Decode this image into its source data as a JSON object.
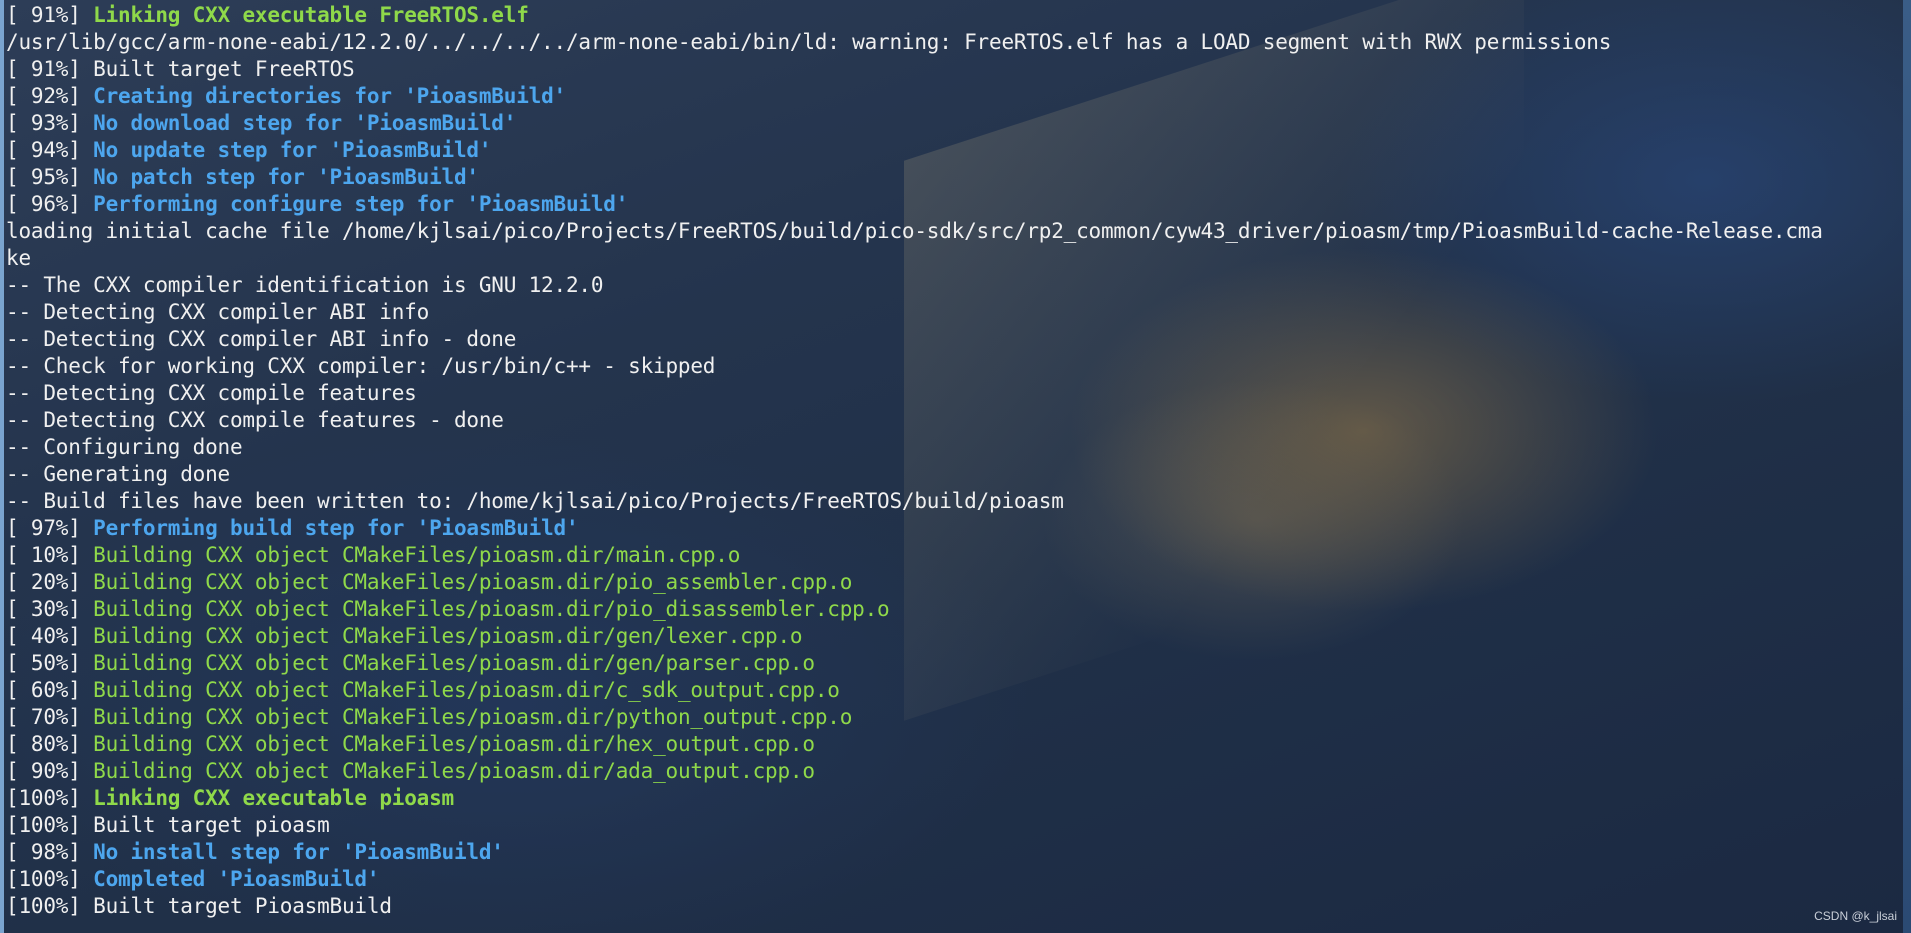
{
  "terminal": {
    "lines": [
      {
        "pct": "[ 91%]",
        "text": "Linking CXX executable FreeRTOS.elf",
        "style": "green-bold"
      },
      {
        "pct": "",
        "text": "/usr/lib/gcc/arm-none-eabi/12.2.0/../../../../arm-none-eabi/bin/ld: warning: FreeRTOS.elf has a LOAD segment with RWX permissions",
        "style": "default"
      },
      {
        "pct": "[ 91%]",
        "text": "Built target FreeRTOS",
        "style": "default"
      },
      {
        "pct": "[ 92%]",
        "text": "Creating directories for 'PioasmBuild'",
        "style": "blue-bold"
      },
      {
        "pct": "[ 93%]",
        "text": "No download step for 'PioasmBuild'",
        "style": "blue-bold"
      },
      {
        "pct": "[ 94%]",
        "text": "No update step for 'PioasmBuild'",
        "style": "blue-bold"
      },
      {
        "pct": "[ 95%]",
        "text": "No patch step for 'PioasmBuild'",
        "style": "blue-bold"
      },
      {
        "pct": "[ 96%]",
        "text": "Performing configure step for 'PioasmBuild'",
        "style": "blue-bold"
      },
      {
        "pct": "",
        "text": "loading initial cache file /home/kjlsai/pico/Projects/FreeRTOS/build/pico-sdk/src/rp2_common/cyw43_driver/pioasm/tmp/PioasmBuild-cache-Release.cma",
        "style": "default"
      },
      {
        "pct": "",
        "text": "ke",
        "style": "default"
      },
      {
        "pct": "",
        "text": "-- The CXX compiler identification is GNU 12.2.0",
        "style": "default"
      },
      {
        "pct": "",
        "text": "-- Detecting CXX compiler ABI info",
        "style": "default"
      },
      {
        "pct": "",
        "text": "-- Detecting CXX compiler ABI info - done",
        "style": "default"
      },
      {
        "pct": "",
        "text": "-- Check for working CXX compiler: /usr/bin/c++ - skipped",
        "style": "default"
      },
      {
        "pct": "",
        "text": "-- Detecting CXX compile features",
        "style": "default"
      },
      {
        "pct": "",
        "text": "-- Detecting CXX compile features - done",
        "style": "default"
      },
      {
        "pct": "",
        "text": "-- Configuring done",
        "style": "default"
      },
      {
        "pct": "",
        "text": "-- Generating done",
        "style": "default"
      },
      {
        "pct": "",
        "text": "-- Build files have been written to: /home/kjlsai/pico/Projects/FreeRTOS/build/pioasm",
        "style": "default"
      },
      {
        "pct": "[ 97%]",
        "text": "Performing build step for 'PioasmBuild'",
        "style": "blue-bold"
      },
      {
        "pct": "[ 10%]",
        "text": "Building CXX object CMakeFiles/pioasm.dir/main.cpp.o",
        "style": "green"
      },
      {
        "pct": "[ 20%]",
        "text": "Building CXX object CMakeFiles/pioasm.dir/pio_assembler.cpp.o",
        "style": "green"
      },
      {
        "pct": "[ 30%]",
        "text": "Building CXX object CMakeFiles/pioasm.dir/pio_disassembler.cpp.o",
        "style": "green"
      },
      {
        "pct": "[ 40%]",
        "text": "Building CXX object CMakeFiles/pioasm.dir/gen/lexer.cpp.o",
        "style": "green"
      },
      {
        "pct": "[ 50%]",
        "text": "Building CXX object CMakeFiles/pioasm.dir/gen/parser.cpp.o",
        "style": "green"
      },
      {
        "pct": "[ 60%]",
        "text": "Building CXX object CMakeFiles/pioasm.dir/c_sdk_output.cpp.o",
        "style": "green"
      },
      {
        "pct": "[ 70%]",
        "text": "Building CXX object CMakeFiles/pioasm.dir/python_output.cpp.o",
        "style": "green"
      },
      {
        "pct": "[ 80%]",
        "text": "Building CXX object CMakeFiles/pioasm.dir/hex_output.cpp.o",
        "style": "green"
      },
      {
        "pct": "[ 90%]",
        "text": "Building CXX object CMakeFiles/pioasm.dir/ada_output.cpp.o",
        "style": "green"
      },
      {
        "pct": "[100%]",
        "text": "Linking CXX executable pioasm",
        "style": "green-bold"
      },
      {
        "pct": "[100%]",
        "text": "Built target pioasm",
        "style": "default"
      },
      {
        "pct": "[ 98%]",
        "text": "No install step for 'PioasmBuild'",
        "style": "blue-bold"
      },
      {
        "pct": "[100%]",
        "text": "Completed 'PioasmBuild'",
        "style": "blue-bold"
      },
      {
        "pct": "[100%]",
        "text": "Built target PioasmBuild",
        "style": "default"
      }
    ]
  },
  "watermark": "CSDN @k_jlsai",
  "colors": {
    "text_default": "#f0f0f0",
    "text_green": "#8fd94a",
    "text_blue": "#4da6ee"
  }
}
